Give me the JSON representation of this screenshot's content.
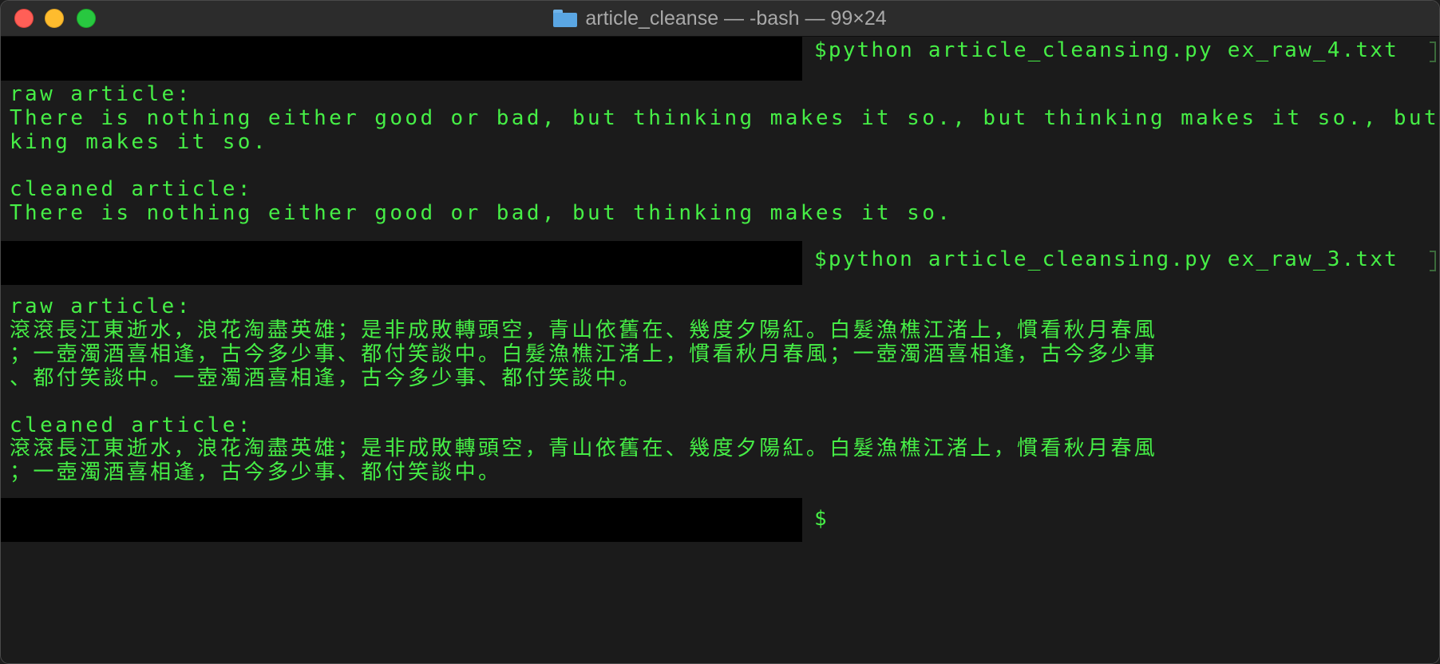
{
  "window": {
    "title": "article_cleanse — -bash — 99×24",
    "folder_icon": "folder-icon"
  },
  "terminal": {
    "prompt1": "$python article_cleansing.py ex_raw_4.txt",
    "label_raw_1": "raw article:",
    "raw_1_line1": "There is nothing either good or bad, but thinking makes it so., but thinking makes it so., but thin",
    "raw_1_line2": "king makes it so.",
    "label_clean_1": "cleaned article:",
    "clean_1_line1": "There is nothing either good or bad, but thinking makes it so.",
    "prompt2": "$python article_cleansing.py ex_raw_3.txt",
    "label_raw_2": "raw article:",
    "raw_2_line1": "滾滾長江東逝水，浪花淘盡英雄；是非成敗轉頭空，青山依舊在、幾度夕陽紅。白髮漁樵江渚上，慣看秋月春風",
    "raw_2_line2": "；一壺濁酒喜相逢，古今多少事、都付笑談中。白髮漁樵江渚上，慣看秋月春風；一壺濁酒喜相逢，古今多少事",
    "raw_2_line3": "、都付笑談中。一壺濁酒喜相逢，古今多少事、都付笑談中。",
    "label_clean_2": "cleaned article:",
    "clean_2_line1": "滾滾長江東逝水，浪花淘盡英雄；是非成敗轉頭空，青山依舊在、幾度夕陽紅。白髮漁樵江渚上，慣看秋月春風",
    "clean_2_line2": "；一壺濁酒喜相逢，古今多少事、都付笑談中。",
    "prompt3": "$"
  },
  "colors": {
    "text": "#46ee46",
    "background": "#1b1b1b",
    "prompt_block": "#000000"
  }
}
